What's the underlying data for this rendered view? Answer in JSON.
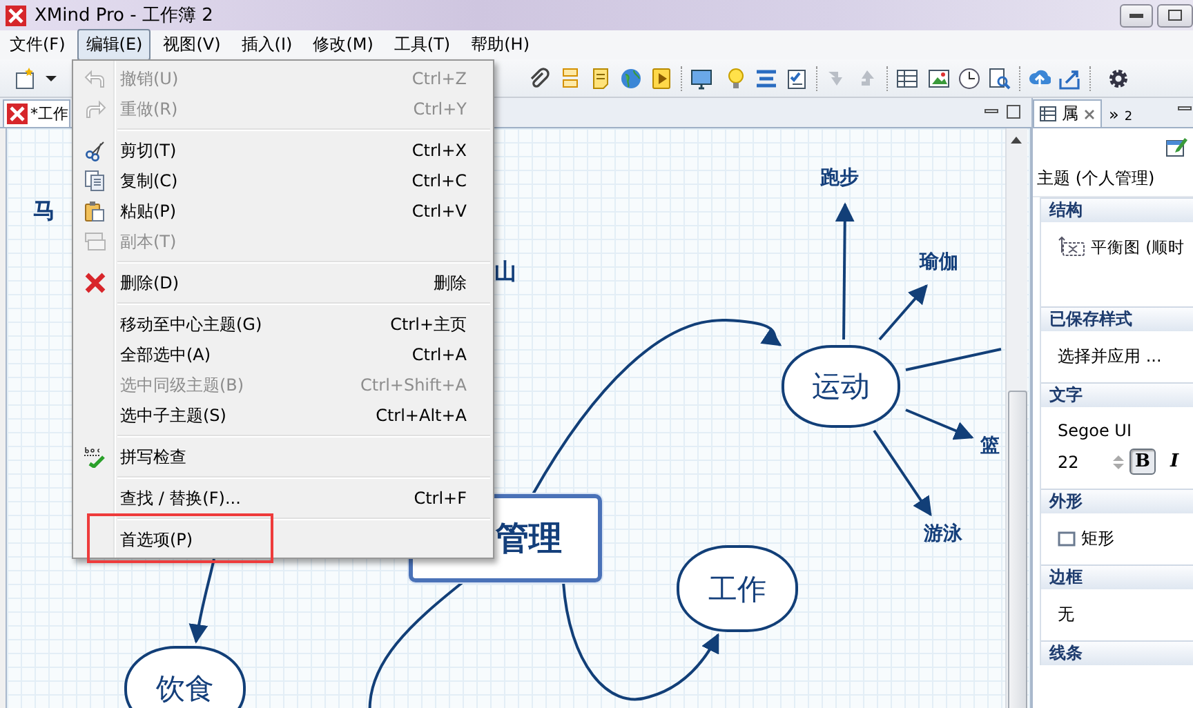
{
  "window": {
    "title": "XMind Pro - 工作簿 2"
  },
  "menu_bar": [
    {
      "label": "文件(F)",
      "selected": false
    },
    {
      "label": "编辑(E)",
      "selected": true
    },
    {
      "label": "视图(V)",
      "selected": false
    },
    {
      "label": "插入(I)",
      "selected": false
    },
    {
      "label": "修改(M)",
      "selected": false
    },
    {
      "label": "工具(T)",
      "selected": false
    },
    {
      "label": "帮助(H)",
      "selected": false
    }
  ],
  "editor_tab": {
    "label": "*工作"
  },
  "mind_map": {
    "nodes": [
      {
        "text": "马",
        "kind": "floating"
      },
      {
        "text": "山",
        "kind": "floating"
      },
      {
        "text": "管理",
        "kind": "central",
        "selected": true
      },
      {
        "text": "运动",
        "kind": "main"
      },
      {
        "text": "跑步",
        "kind": "sub"
      },
      {
        "text": "瑜伽",
        "kind": "sub"
      },
      {
        "text": "篮",
        "kind": "sub"
      },
      {
        "text": "游泳",
        "kind": "sub"
      },
      {
        "text": "工作",
        "kind": "main"
      },
      {
        "text": "饮食",
        "kind": "main"
      }
    ]
  },
  "edit_menu": {
    "groups": [
      [
        {
          "label": "撤销(U)",
          "shortcut": "Ctrl+Z",
          "disabled": true
        },
        {
          "label": "重做(R)",
          "shortcut": "Ctrl+Y",
          "disabled": true
        }
      ],
      [
        {
          "label": "剪切(T)",
          "shortcut": "Ctrl+X",
          "disabled": false
        },
        {
          "label": "复制(C)",
          "shortcut": "Ctrl+C",
          "disabled": false
        },
        {
          "label": "粘贴(P)",
          "shortcut": "Ctrl+V",
          "disabled": false
        },
        {
          "label": "副本(T)",
          "disabled": true
        }
      ],
      [
        {
          "label": "删除(D)",
          "shortcut": "删除",
          "disabled": false
        }
      ],
      [
        {
          "label": "移动至中心主题(G)",
          "shortcut": "Ctrl+主页",
          "disabled": false
        },
        {
          "label": "全部选中(A)",
          "shortcut": "Ctrl+A",
          "disabled": false
        },
        {
          "label": "选中同级主题(B)",
          "shortcut": "Ctrl+Shift+A",
          "disabled": true
        },
        {
          "label": "选中子主题(S)",
          "shortcut": "Ctrl+Alt+A",
          "disabled": false
        }
      ],
      [
        {
          "label": "拼写检查",
          "disabled": false
        }
      ],
      [
        {
          "label": "查找 / 替换(F)...",
          "shortcut": "Ctrl+F",
          "disabled": false
        }
      ],
      [
        {
          "label": "首选项(P)",
          "disabled": false
        }
      ]
    ]
  },
  "properties_panel": {
    "tabs": [
      {
        "label": "属",
        "selected": true
      },
      {
        "label": "»",
        "count": "2",
        "selected": false
      }
    ],
    "subject": "主题 (个人管理)",
    "sections": [
      {
        "title": "结构",
        "kind": "structure",
        "value": "平衡图 (顺时"
      },
      {
        "title": "已保存样式",
        "kind": "text",
        "value": "选择并应用 ..."
      },
      {
        "title": "文字",
        "kind": "font",
        "font": "Segoe UI",
        "size": "22",
        "bold_label": "B",
        "bold": true,
        "italic_label": "I",
        "italic": false
      },
      {
        "title": "外形",
        "kind": "shape",
        "value": "矩形"
      },
      {
        "title": "边框",
        "kind": "text",
        "value": "无"
      },
      {
        "title": "线条",
        "kind": "header"
      }
    ]
  }
}
